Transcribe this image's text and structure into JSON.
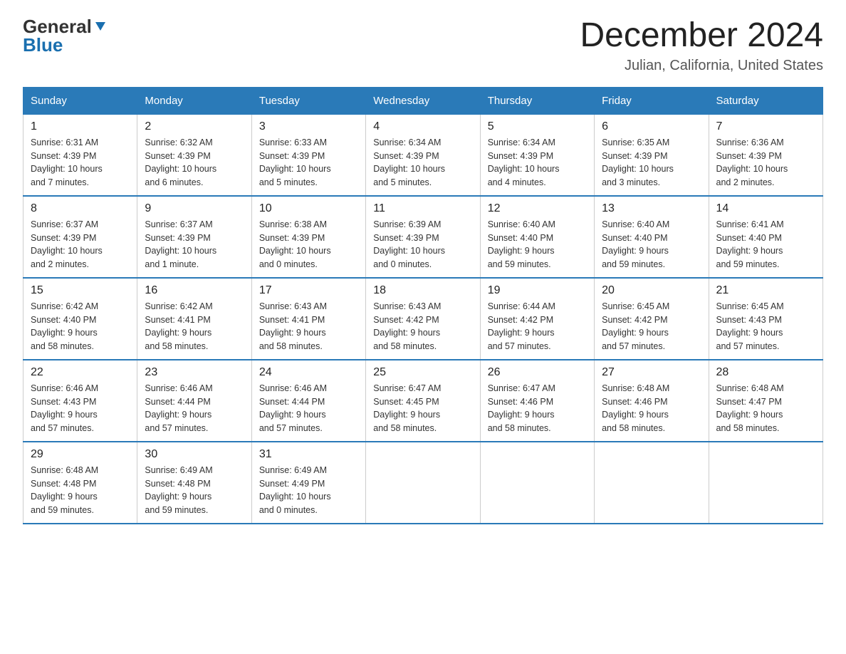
{
  "header": {
    "logo_general": "General",
    "logo_blue": "Blue",
    "month_title": "December 2024",
    "location": "Julian, California, United States"
  },
  "days_of_week": [
    "Sunday",
    "Monday",
    "Tuesday",
    "Wednesday",
    "Thursday",
    "Friday",
    "Saturday"
  ],
  "weeks": [
    [
      {
        "day": "1",
        "sunrise": "6:31 AM",
        "sunset": "4:39 PM",
        "daylight": "10 hours and 7 minutes."
      },
      {
        "day": "2",
        "sunrise": "6:32 AM",
        "sunset": "4:39 PM",
        "daylight": "10 hours and 6 minutes."
      },
      {
        "day": "3",
        "sunrise": "6:33 AM",
        "sunset": "4:39 PM",
        "daylight": "10 hours and 5 minutes."
      },
      {
        "day": "4",
        "sunrise": "6:34 AM",
        "sunset": "4:39 PM",
        "daylight": "10 hours and 5 minutes."
      },
      {
        "day": "5",
        "sunrise": "6:34 AM",
        "sunset": "4:39 PM",
        "daylight": "10 hours and 4 minutes."
      },
      {
        "day": "6",
        "sunrise": "6:35 AM",
        "sunset": "4:39 PM",
        "daylight": "10 hours and 3 minutes."
      },
      {
        "day": "7",
        "sunrise": "6:36 AM",
        "sunset": "4:39 PM",
        "daylight": "10 hours and 2 minutes."
      }
    ],
    [
      {
        "day": "8",
        "sunrise": "6:37 AM",
        "sunset": "4:39 PM",
        "daylight": "10 hours and 2 minutes."
      },
      {
        "day": "9",
        "sunrise": "6:37 AM",
        "sunset": "4:39 PM",
        "daylight": "10 hours and 1 minute."
      },
      {
        "day": "10",
        "sunrise": "6:38 AM",
        "sunset": "4:39 PM",
        "daylight": "10 hours and 0 minutes."
      },
      {
        "day": "11",
        "sunrise": "6:39 AM",
        "sunset": "4:39 PM",
        "daylight": "10 hours and 0 minutes."
      },
      {
        "day": "12",
        "sunrise": "6:40 AM",
        "sunset": "4:40 PM",
        "daylight": "9 hours and 59 minutes."
      },
      {
        "day": "13",
        "sunrise": "6:40 AM",
        "sunset": "4:40 PM",
        "daylight": "9 hours and 59 minutes."
      },
      {
        "day": "14",
        "sunrise": "6:41 AM",
        "sunset": "4:40 PM",
        "daylight": "9 hours and 59 minutes."
      }
    ],
    [
      {
        "day": "15",
        "sunrise": "6:42 AM",
        "sunset": "4:40 PM",
        "daylight": "9 hours and 58 minutes."
      },
      {
        "day": "16",
        "sunrise": "6:42 AM",
        "sunset": "4:41 PM",
        "daylight": "9 hours and 58 minutes."
      },
      {
        "day": "17",
        "sunrise": "6:43 AM",
        "sunset": "4:41 PM",
        "daylight": "9 hours and 58 minutes."
      },
      {
        "day": "18",
        "sunrise": "6:43 AM",
        "sunset": "4:42 PM",
        "daylight": "9 hours and 58 minutes."
      },
      {
        "day": "19",
        "sunrise": "6:44 AM",
        "sunset": "4:42 PM",
        "daylight": "9 hours and 57 minutes."
      },
      {
        "day": "20",
        "sunrise": "6:45 AM",
        "sunset": "4:42 PM",
        "daylight": "9 hours and 57 minutes."
      },
      {
        "day": "21",
        "sunrise": "6:45 AM",
        "sunset": "4:43 PM",
        "daylight": "9 hours and 57 minutes."
      }
    ],
    [
      {
        "day": "22",
        "sunrise": "6:46 AM",
        "sunset": "4:43 PM",
        "daylight": "9 hours and 57 minutes."
      },
      {
        "day": "23",
        "sunrise": "6:46 AM",
        "sunset": "4:44 PM",
        "daylight": "9 hours and 57 minutes."
      },
      {
        "day": "24",
        "sunrise": "6:46 AM",
        "sunset": "4:44 PM",
        "daylight": "9 hours and 57 minutes."
      },
      {
        "day": "25",
        "sunrise": "6:47 AM",
        "sunset": "4:45 PM",
        "daylight": "9 hours and 58 minutes."
      },
      {
        "day": "26",
        "sunrise": "6:47 AM",
        "sunset": "4:46 PM",
        "daylight": "9 hours and 58 minutes."
      },
      {
        "day": "27",
        "sunrise": "6:48 AM",
        "sunset": "4:46 PM",
        "daylight": "9 hours and 58 minutes."
      },
      {
        "day": "28",
        "sunrise": "6:48 AM",
        "sunset": "4:47 PM",
        "daylight": "9 hours and 58 minutes."
      }
    ],
    [
      {
        "day": "29",
        "sunrise": "6:48 AM",
        "sunset": "4:48 PM",
        "daylight": "9 hours and 59 minutes."
      },
      {
        "day": "30",
        "sunrise": "6:49 AM",
        "sunset": "4:48 PM",
        "daylight": "9 hours and 59 minutes."
      },
      {
        "day": "31",
        "sunrise": "6:49 AM",
        "sunset": "4:49 PM",
        "daylight": "10 hours and 0 minutes."
      },
      null,
      null,
      null,
      null
    ]
  ],
  "labels": {
    "sunrise": "Sunrise:",
    "sunset": "Sunset:",
    "daylight": "Daylight:"
  },
  "colors": {
    "header_bg": "#2a7ab8",
    "header_text": "#ffffff",
    "border": "#2a7ab8",
    "logo_blue": "#1a6faf"
  }
}
